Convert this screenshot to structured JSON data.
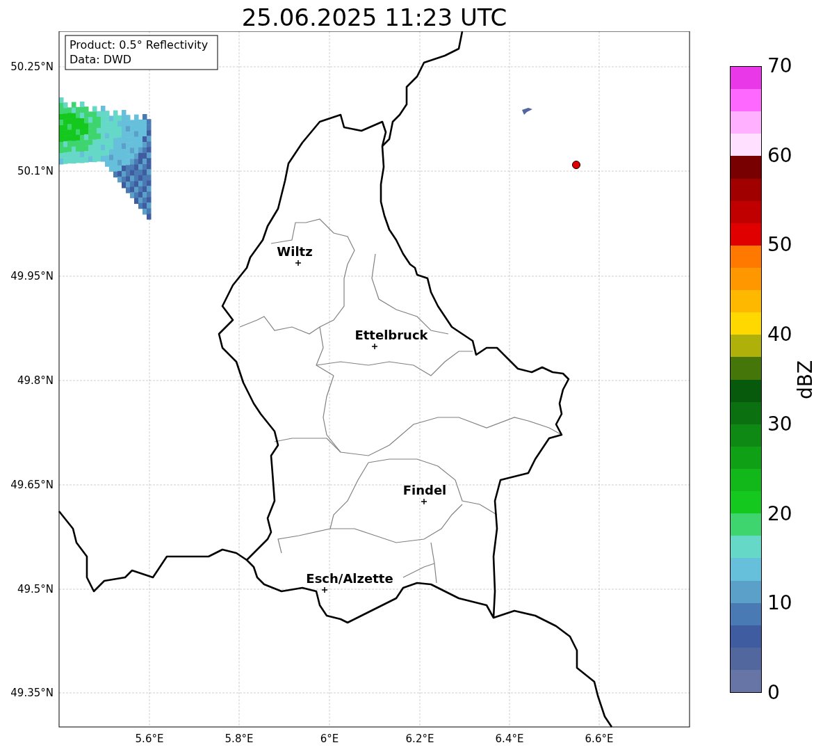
{
  "title": "25.06.2025 11:23 UTC",
  "info_box": {
    "lines": [
      "Product: 0.5° Reflectivity",
      "Data: DWD"
    ]
  },
  "map": {
    "lat_ticks": [
      "50.25°N",
      "50.1°N",
      "49.95°N",
      "49.8°N",
      "49.65°N",
      "49.5°N",
      "49.35°N"
    ],
    "lon_ticks": [
      "5.6°E",
      "5.8°E",
      "6°E",
      "6.2°E",
      "6.4°E",
      "6.6°E"
    ],
    "places": [
      {
        "name": "Wiltz"
      },
      {
        "name": "Ettelbruck"
      },
      {
        "name": "Findel"
      },
      {
        "name": "Esch/Alzette"
      }
    ]
  },
  "colorbar": {
    "label": "dBZ",
    "ticks": [
      "70",
      "60",
      "50",
      "40",
      "30",
      "20",
      "10",
      "0"
    ],
    "bins": [
      {
        "color": "#6674a6"
      },
      {
        "color": "#52679e"
      },
      {
        "color": "#405ca0"
      },
      {
        "color": "#4a7ab4"
      },
      {
        "color": "#5aa0c8"
      },
      {
        "color": "#66c0dc"
      },
      {
        "color": "#66d8c8"
      },
      {
        "color": "#3ed46e"
      },
      {
        "color": "#14c81e"
      },
      {
        "color": "#12b81a"
      },
      {
        "color": "#10a016"
      },
      {
        "color": "#0e8a14"
      },
      {
        "color": "#0a7010"
      },
      {
        "color": "#075a0c"
      },
      {
        "color": "#45760a"
      },
      {
        "color": "#b0b00a"
      },
      {
        "color": "#ffd800"
      },
      {
        "color": "#ffb800"
      },
      {
        "color": "#ff9800"
      },
      {
        "color": "#ff7800"
      },
      {
        "color": "#e00000"
      },
      {
        "color": "#c00000"
      },
      {
        "color": "#a00000"
      },
      {
        "color": "#780000"
      },
      {
        "color": "#ffe0ff"
      },
      {
        "color": "#ffb0ff"
      },
      {
        "color": "#ff68ff"
      },
      {
        "color": "#e838e8"
      }
    ]
  }
}
